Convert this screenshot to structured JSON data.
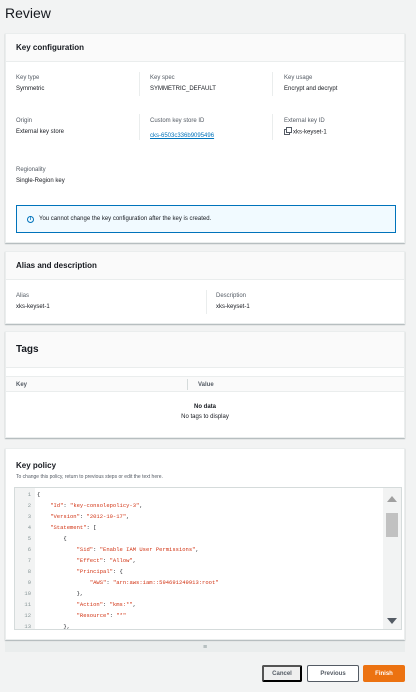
{
  "page": {
    "title": "Review"
  },
  "key_configuration": {
    "header": "Key configuration",
    "key_type": {
      "label": "Key type",
      "value": "Symmetric"
    },
    "key_spec": {
      "label": "Key spec",
      "value": "SYMMETRIC_DEFAULT"
    },
    "key_usage": {
      "label": "Key usage",
      "value": "Encrypt and decrypt"
    },
    "origin": {
      "label": "Origin",
      "value": "External key store"
    },
    "custom_key_store": {
      "label": "Custom key store ID",
      "value": "cks-6503c336b9095496"
    },
    "external_key": {
      "label": "External key ID",
      "value": "xks-keyset-1"
    },
    "regionality": {
      "label": "Regionality",
      "value": "Single-Region key"
    },
    "info": "You cannot change the key configuration after the key is created."
  },
  "alias": {
    "header": "Alias and description",
    "alias": {
      "label": "Alias",
      "value": "xks-keyset-1"
    },
    "description": {
      "label": "Description",
      "value": "xks-keyset-1"
    }
  },
  "tags": {
    "header": "Tags",
    "columns": [
      "Key",
      "Value"
    ],
    "empty_title": "No data",
    "empty_sub": "No tags to display"
  },
  "policy": {
    "header": "Key policy",
    "hint": "To change this policy, return to previous steps or edit the text here.",
    "lines": [
      {
        "n": "1",
        "text": "{"
      },
      {
        "n": "2",
        "text": "    \"Id\": \"key-consolepolicy-3\","
      },
      {
        "n": "3",
        "text": "    \"Version\": \"2012-10-17\","
      },
      {
        "n": "4",
        "text": "    \"Statement\": ["
      },
      {
        "n": "5",
        "text": "        {"
      },
      {
        "n": "6",
        "text": "            \"Sid\": \"Enable IAM User Permissions\","
      },
      {
        "n": "7",
        "text": "            \"Effect\": \"Allow\","
      },
      {
        "n": "8",
        "text": "            \"Principal\": {"
      },
      {
        "n": "9",
        "text": "                \"AWS\": \"arn:aws:iam::594691249913:root\""
      },
      {
        "n": "10",
        "text": "            },"
      },
      {
        "n": "11",
        "text": "            \"Action\": \"kms:*\","
      },
      {
        "n": "12",
        "text": "            \"Resource\": \"*\""
      },
      {
        "n": "13",
        "text": "        },"
      }
    ]
  },
  "footer": {
    "cancel": "Cancel",
    "previous": "Previous",
    "finish": "Finish"
  }
}
